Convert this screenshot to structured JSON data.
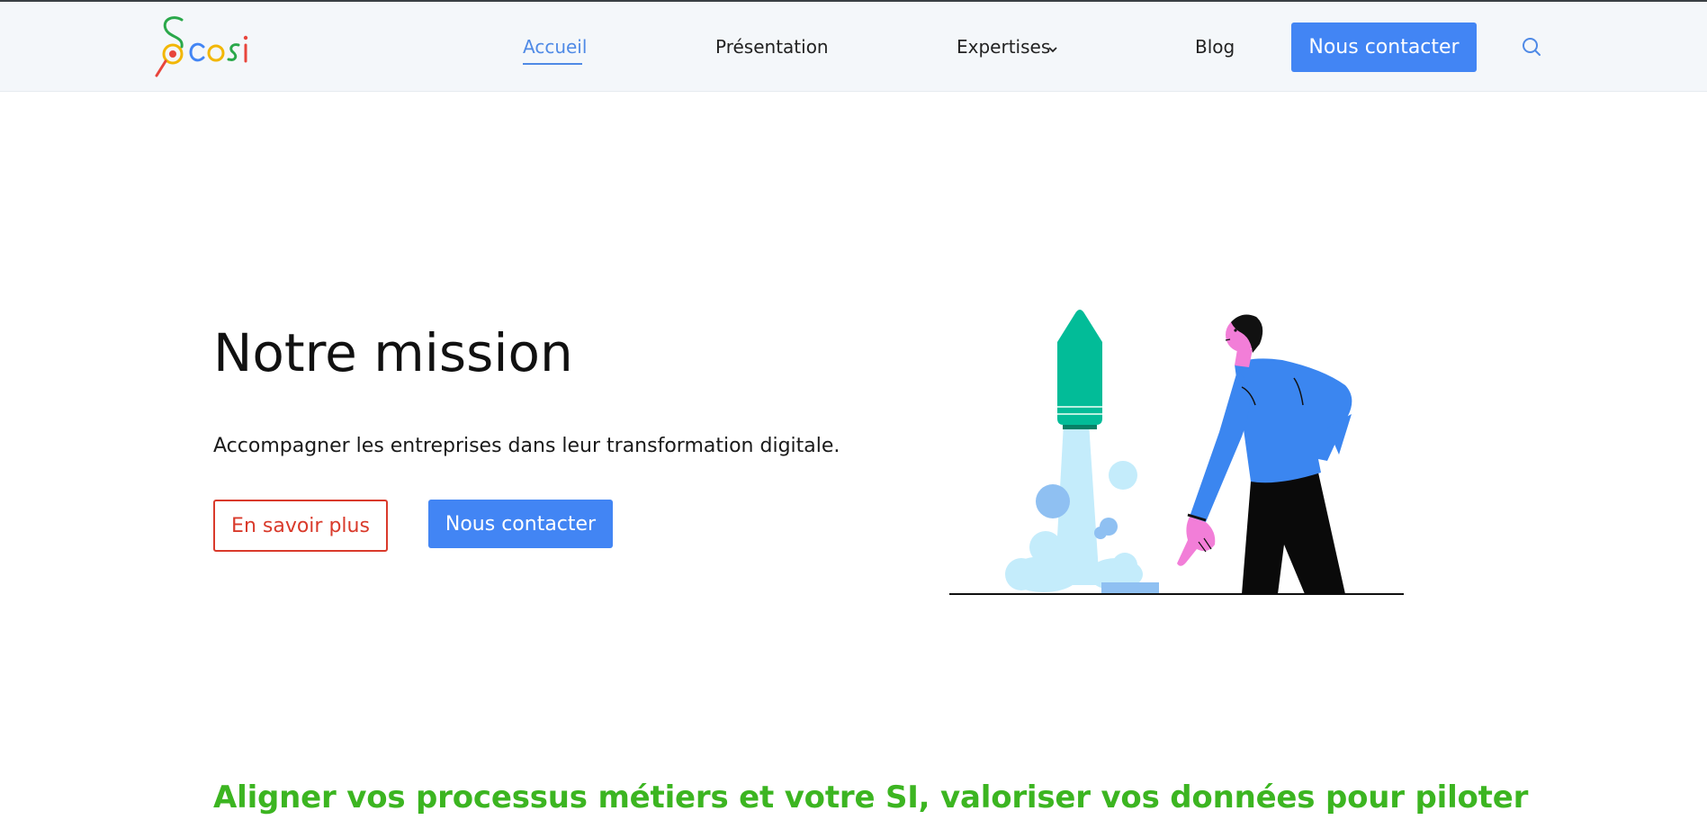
{
  "header": {
    "logo_alt": "cosi",
    "nav": {
      "home": "Accueil",
      "presentation": "Présentation",
      "expertises": "Expertises",
      "blog": "Blog"
    },
    "contact_label": "Nous contacter",
    "search_icon": "search-icon"
  },
  "hero": {
    "title": "Notre mission",
    "description": "Accompagner les entreprises dans leur transformation digitale.",
    "more_label": "En savoir plus",
    "contact_label": "Nous contacter"
  },
  "section": {
    "tagline": "Aligner vos processus métiers et votre SI, valoriser vos données pour piloter"
  },
  "colors": {
    "accent": "#4285f4",
    "nav_active": "#4f8ae6",
    "outline_red": "#d93a2b",
    "tagline_green": "#3cb521"
  }
}
